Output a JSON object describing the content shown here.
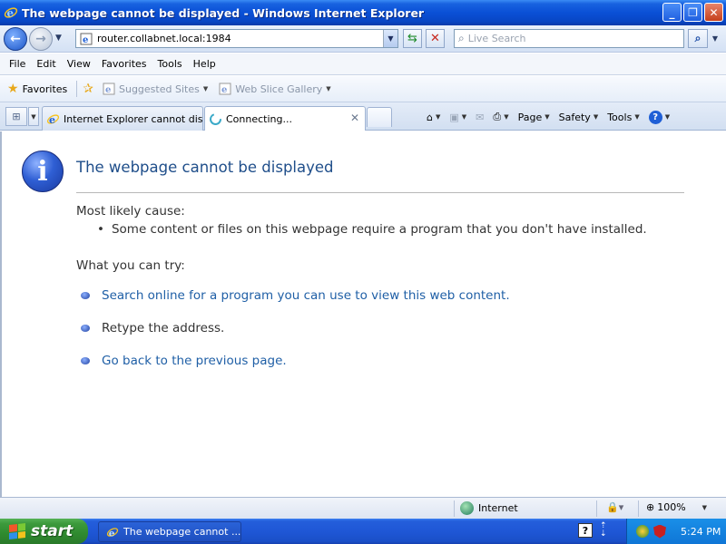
{
  "window": {
    "title": "The webpage cannot be displayed - Windows Internet Explorer",
    "minimize_label": "_",
    "restore_label": "❐",
    "close_label": "✕"
  },
  "address": {
    "url": "router.collabnet.local:1984",
    "search_placeholder": "Live Search"
  },
  "menu": [
    "File",
    "Edit",
    "View",
    "Favorites",
    "Tools",
    "Help"
  ],
  "favorites_bar": {
    "favorites_label": "Favorites",
    "links": [
      "Suggested Sites",
      "Web Slice Gallery"
    ]
  },
  "tabs": [
    {
      "label": "Internet Explorer cannot dis...",
      "active": false
    },
    {
      "label": "Connecting...",
      "active": true
    }
  ],
  "command_bar": {
    "page": "Page",
    "safety": "Safety",
    "tools": "Tools"
  },
  "content": {
    "title": "The webpage cannot be displayed",
    "cause_label": "Most likely cause:",
    "cause": "Some content or files on this webpage require a program that you don't have installed.",
    "try_label": "What you can try:",
    "try_items": [
      {
        "text": "Search online for a program you can use to view this web content.",
        "link": true
      },
      {
        "text": "Retype the address.",
        "link": false
      },
      {
        "text": "Go back to the previous page.",
        "link": true
      }
    ]
  },
  "status": {
    "zone": "Internet",
    "zoom": "100%"
  },
  "taskbar": {
    "start_label": "start",
    "task_label": "The webpage cannot ...",
    "help_label": "?",
    "clock": "5:24 PM"
  },
  "colors": {
    "title_bar": "#0a50d6",
    "error_title": "#1f4e8a",
    "link": "#1f5fa6",
    "start_green": "#3c9a3c"
  }
}
